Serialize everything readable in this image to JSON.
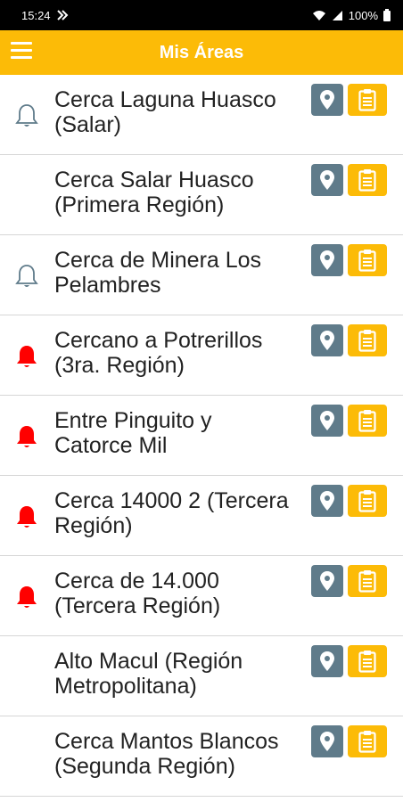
{
  "status": {
    "time": "15:24",
    "battery": "100%"
  },
  "header": {
    "title": "Mis Áreas"
  },
  "colors": {
    "accent": "#fcbb07",
    "map_button": "#5f7b8a",
    "alert_active": "#ff0000",
    "alert_inactive": "#5f7b8a"
  },
  "areas": [
    {
      "line1": "Cerca Laguna Huasco",
      "line2": "(Salar)",
      "bell": "outline"
    },
    {
      "line1": "Cerca Salar Huasco",
      "line2": "(Primera Región)",
      "bell": "none"
    },
    {
      "line1": "Cerca de Minera Los",
      "line2": "Pelambres",
      "bell": "outline"
    },
    {
      "line1": "Cercano a Potrerillos",
      "line2": "(3ra. Región)",
      "bell": "filled"
    },
    {
      "line1": "Entre Pinguito y",
      "line2": "Catorce Mil",
      "bell": "filled"
    },
    {
      "line1": "Cerca 14000 2 (Tercera",
      "line2": "Región)",
      "bell": "filled"
    },
    {
      "line1": "Cerca de 14.000",
      "line2": "(Tercera Región)",
      "bell": "filled"
    },
    {
      "line1": "Alto Macul (Región",
      "line2": "Metropolitana)",
      "bell": "none"
    },
    {
      "line1": "Cerca Mantos Blancos",
      "line2": "(Segunda Región)",
      "bell": "none"
    }
  ]
}
